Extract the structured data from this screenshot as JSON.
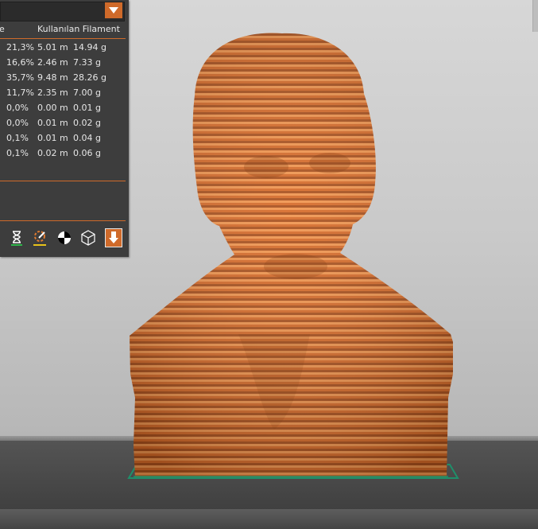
{
  "panel": {
    "header": {
      "partial": "e",
      "filament": "Kullanılan Filament"
    },
    "rows": [
      {
        "pct": "21,3%",
        "length": "5.01 m",
        "weight": "14.94 g"
      },
      {
        "pct": "16,6%",
        "length": "2.46 m",
        "weight": "7.33 g"
      },
      {
        "pct": "35,7%",
        "length": "9.48 m",
        "weight": "28.26 g"
      },
      {
        "pct": "11,7%",
        "length": "2.35 m",
        "weight": "7.00 g"
      },
      {
        "pct": "0,0%",
        "length": "0.00 m",
        "weight": "0.01 g"
      },
      {
        "pct": "0,0%",
        "length": "0.01 m",
        "weight": "0.02 g"
      },
      {
        "pct": "0,1%",
        "length": "0.01 m",
        "weight": "0.04 g"
      },
      {
        "pct": "0,1%",
        "length": "0.02 m",
        "weight": "0.06 g"
      }
    ],
    "toolbar": {
      "icons": [
        "hourglass-icon",
        "paint-settings-icon",
        "balance-icon",
        "cube-icon",
        "export-down-arrow-icon"
      ]
    }
  },
  "colors": {
    "accent": "#cf6a2a",
    "model": "#d9712e",
    "panel_bg": "#3d3d3d",
    "bed_outline": "#1f8f6a"
  }
}
